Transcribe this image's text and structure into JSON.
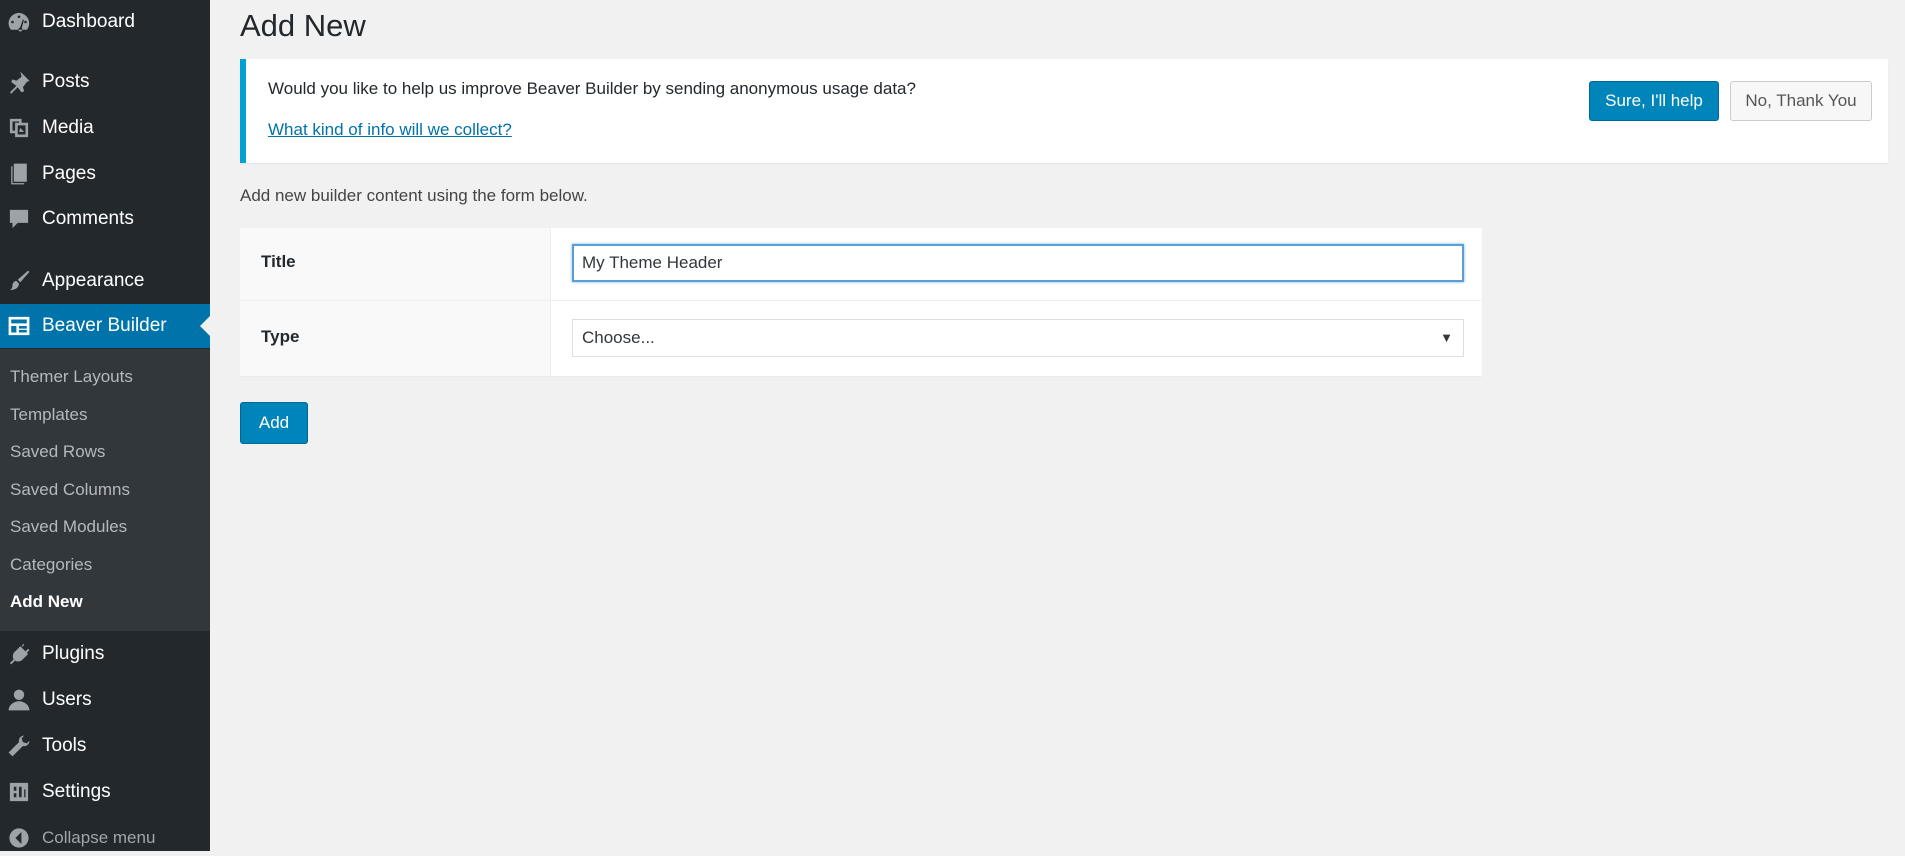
{
  "sidebar": {
    "items": [
      {
        "label": "Dashboard",
        "icon": "dashboard-icon"
      },
      {
        "label": "Posts",
        "icon": "pin-icon"
      },
      {
        "label": "Media",
        "icon": "media-icon"
      },
      {
        "label": "Pages",
        "icon": "pages-icon"
      },
      {
        "label": "Comments",
        "icon": "comment-icon"
      },
      {
        "label": "Appearance",
        "icon": "brush-icon"
      },
      {
        "label": "Beaver Builder",
        "icon": "layout-icon"
      },
      {
        "label": "Plugins",
        "icon": "plug-icon"
      },
      {
        "label": "Users",
        "icon": "user-icon"
      },
      {
        "label": "Tools",
        "icon": "wrench-icon"
      },
      {
        "label": "Settings",
        "icon": "settings-icon"
      }
    ],
    "submenu": [
      {
        "label": "Themer Layouts"
      },
      {
        "label": "Templates"
      },
      {
        "label": "Saved Rows"
      },
      {
        "label": "Saved Columns"
      },
      {
        "label": "Saved Modules"
      },
      {
        "label": "Categories"
      },
      {
        "label": "Add New"
      }
    ],
    "collapse_label": "Collapse menu"
  },
  "main": {
    "title": "Add New",
    "notice": {
      "text": "Would you like to help us improve Beaver Builder by sending anonymous usage data?",
      "link": "What kind of info will we collect?",
      "accept_label": "Sure, I'll help",
      "decline_label": "No, Thank You"
    },
    "intro": "Add new builder content using the form below.",
    "form": {
      "title_label": "Title",
      "title_value": "My Theme Header",
      "type_label": "Type",
      "type_value": "Choose..."
    },
    "add_label": "Add"
  },
  "colors": {
    "sidebar_bg": "#23282d",
    "submenu_bg": "#32373c",
    "accent": "#0073aa",
    "button": "#0085ba",
    "notice_border": "#00a0d2"
  }
}
